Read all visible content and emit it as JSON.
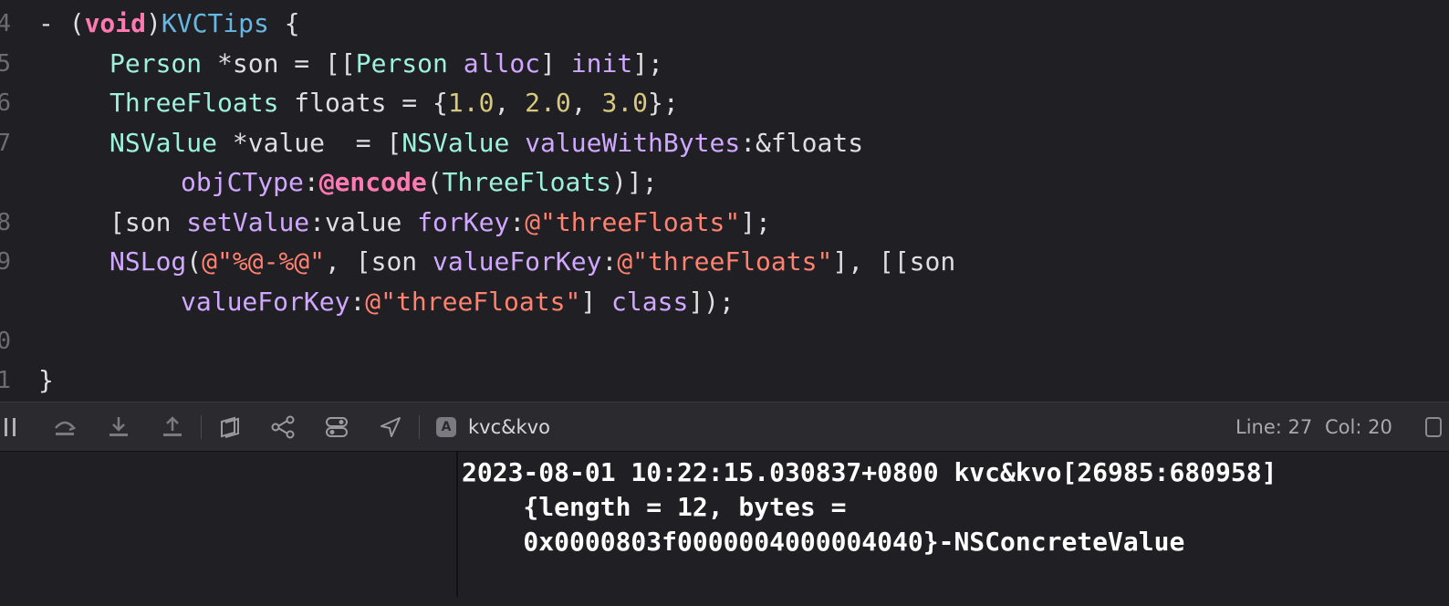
{
  "editor": {
    "line_numbers": [
      "4",
      "5",
      "6",
      "7",
      "8",
      "9",
      "0",
      "1"
    ],
    "code_lines": [
      [
        {
          "t": "- (",
          "c": "tx"
        },
        {
          "t": "void",
          "c": "kw"
        },
        {
          "t": ")",
          "c": "tx"
        },
        {
          "t": "KVCTips",
          "c": "fn"
        },
        {
          "t": " {",
          "c": "tx"
        }
      ],
      [
        {
          "t": "Person",
          "c": "ty"
        },
        {
          "t": " *son = [[",
          "c": "tx"
        },
        {
          "t": "Person",
          "c": "ty"
        },
        {
          "t": " ",
          "c": "tx"
        },
        {
          "t": "alloc",
          "c": "me"
        },
        {
          "t": "] ",
          "c": "tx"
        },
        {
          "t": "init",
          "c": "me"
        },
        {
          "t": "];",
          "c": "tx"
        }
      ],
      [
        {
          "t": "ThreeFloats",
          "c": "ty"
        },
        {
          "t": " floats = {",
          "c": "tx"
        },
        {
          "t": "1.0",
          "c": "nu"
        },
        {
          "t": ", ",
          "c": "tx"
        },
        {
          "t": "2.0",
          "c": "nu"
        },
        {
          "t": ", ",
          "c": "tx"
        },
        {
          "t": "3.0",
          "c": "nu"
        },
        {
          "t": "};",
          "c": "tx"
        }
      ],
      [
        {
          "t": "NSValue",
          "c": "ty"
        },
        {
          "t": " *value  = [",
          "c": "tx"
        },
        {
          "t": "NSValue",
          "c": "ty"
        },
        {
          "t": " ",
          "c": "tx"
        },
        {
          "t": "valueWithBytes",
          "c": "me"
        },
        {
          "t": ":&floats",
          "c": "tx"
        }
      ],
      [
        {
          "t": "objCType",
          "c": "me"
        },
        {
          "t": ":",
          "c": "tx"
        },
        {
          "t": "@encode",
          "c": "kw"
        },
        {
          "t": "(",
          "c": "tx"
        },
        {
          "t": "ThreeFloats",
          "c": "ty"
        },
        {
          "t": ")];",
          "c": "tx"
        }
      ],
      [
        {
          "t": "[son ",
          "c": "tx"
        },
        {
          "t": "setValue",
          "c": "me"
        },
        {
          "t": ":value ",
          "c": "tx"
        },
        {
          "t": "forKey",
          "c": "me"
        },
        {
          "t": ":",
          "c": "tx"
        },
        {
          "t": "@\"threeFloats\"",
          "c": "st"
        },
        {
          "t": "];",
          "c": "tx"
        }
      ],
      [
        {
          "t": "NSLog",
          "c": "me"
        },
        {
          "t": "(",
          "c": "tx"
        },
        {
          "t": "@\"%@-%@\"",
          "c": "st"
        },
        {
          "t": ", [son ",
          "c": "tx"
        },
        {
          "t": "valueForKey",
          "c": "me"
        },
        {
          "t": ":",
          "c": "tx"
        },
        {
          "t": "@\"threeFloats\"",
          "c": "st"
        },
        {
          "t": "], [[son",
          "c": "tx"
        }
      ],
      [
        {
          "t": "valueForKey",
          "c": "me"
        },
        {
          "t": ":",
          "c": "tx"
        },
        {
          "t": "@\"threeFloats\"",
          "c": "st"
        },
        {
          "t": "] ",
          "c": "tx"
        },
        {
          "t": "class",
          "c": "me"
        },
        {
          "t": "]);",
          "c": "tx"
        }
      ],
      [
        {
          "t": "}",
          "c": "tx"
        }
      ]
    ]
  },
  "toolbar": {
    "icons": [
      "sidebar-toggle-icon",
      "step-over-icon",
      "step-into-icon",
      "step-out-icon",
      "debug-view-hierarchy-icon",
      "memory-graph-icon",
      "environment-overrides-icon",
      "simulate-location-icon"
    ],
    "target_badge": "A",
    "target_name": "kvc&kvo",
    "line_label": "Line: 27",
    "col_label": "Col: 20"
  },
  "console": {
    "output_lines": [
      "2023-08-01 10:22:15.030837+0800 kvc&kvo[26985:680958]",
      "    {length = 12, bytes =",
      "    0x0000803f0000004000004040}-NSConcreteValue"
    ]
  },
  "colors": {
    "background": "#1f1f24",
    "toolbar": "#2a2a2f",
    "keyword": "#ff7ab2",
    "type": "#9ef1dd",
    "method": "#d0a8ff",
    "number": "#d9c97c",
    "string": "#ff8170",
    "function_decl": "#67b7e4",
    "plain": "#dfdfe0"
  }
}
